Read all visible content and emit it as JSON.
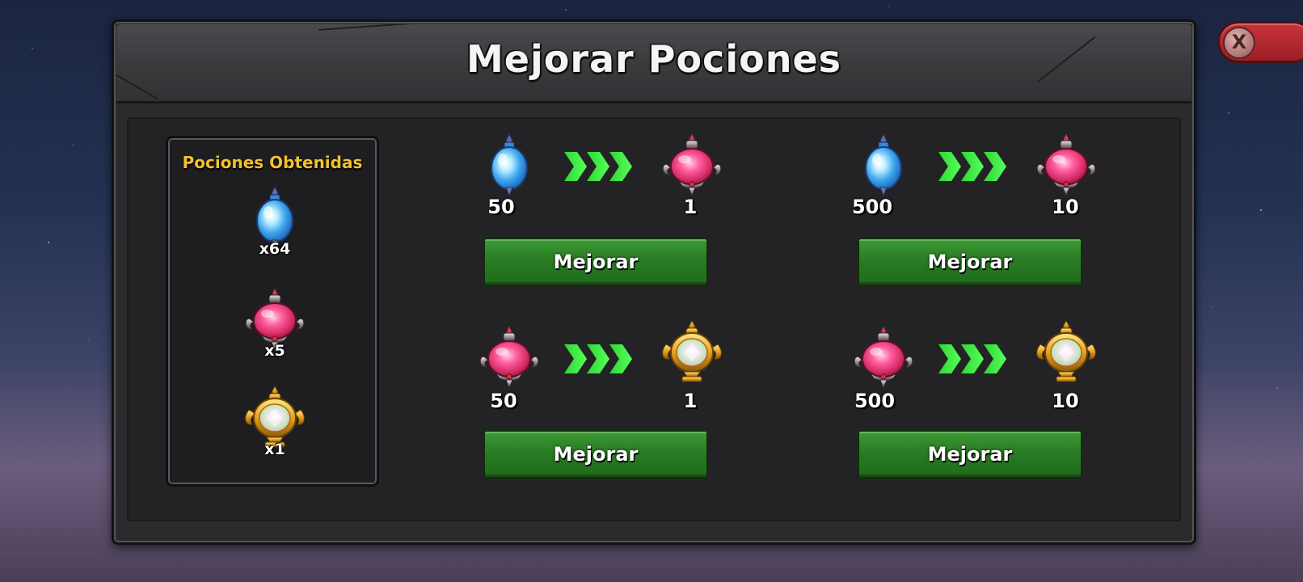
{
  "title": "Mejorar Pociones",
  "close_label": "X",
  "inventory": {
    "title": "Pociones Obtenidas",
    "items": [
      {
        "icon": "blue-potion-icon",
        "count": "x64"
      },
      {
        "icon": "pink-potion-icon",
        "count": "x5"
      },
      {
        "icon": "gold-potion-icon",
        "count": "x1"
      }
    ]
  },
  "recipes": [
    {
      "from_icon": "blue-potion-icon",
      "from_qty": "50",
      "to_icon": "pink-potion-icon",
      "to_qty": "1",
      "button": "Mejorar"
    },
    {
      "from_icon": "blue-potion-icon",
      "from_qty": "500",
      "to_icon": "pink-potion-icon",
      "to_qty": "10",
      "button": "Mejorar"
    },
    {
      "from_icon": "pink-potion-icon",
      "from_qty": "50",
      "to_icon": "gold-potion-icon",
      "to_qty": "1",
      "button": "Mejorar"
    },
    {
      "from_icon": "pink-potion-icon",
      "from_qty": "500",
      "to_icon": "gold-potion-icon",
      "to_qty": "10",
      "button": "Mejorar"
    }
  ],
  "colors": {
    "title_text": "#f4f4f4",
    "inventory_title": "#f2c12e",
    "button_green": "#2a7d24",
    "arrow_green": "#35e23a",
    "close_red": "#c8323a"
  }
}
